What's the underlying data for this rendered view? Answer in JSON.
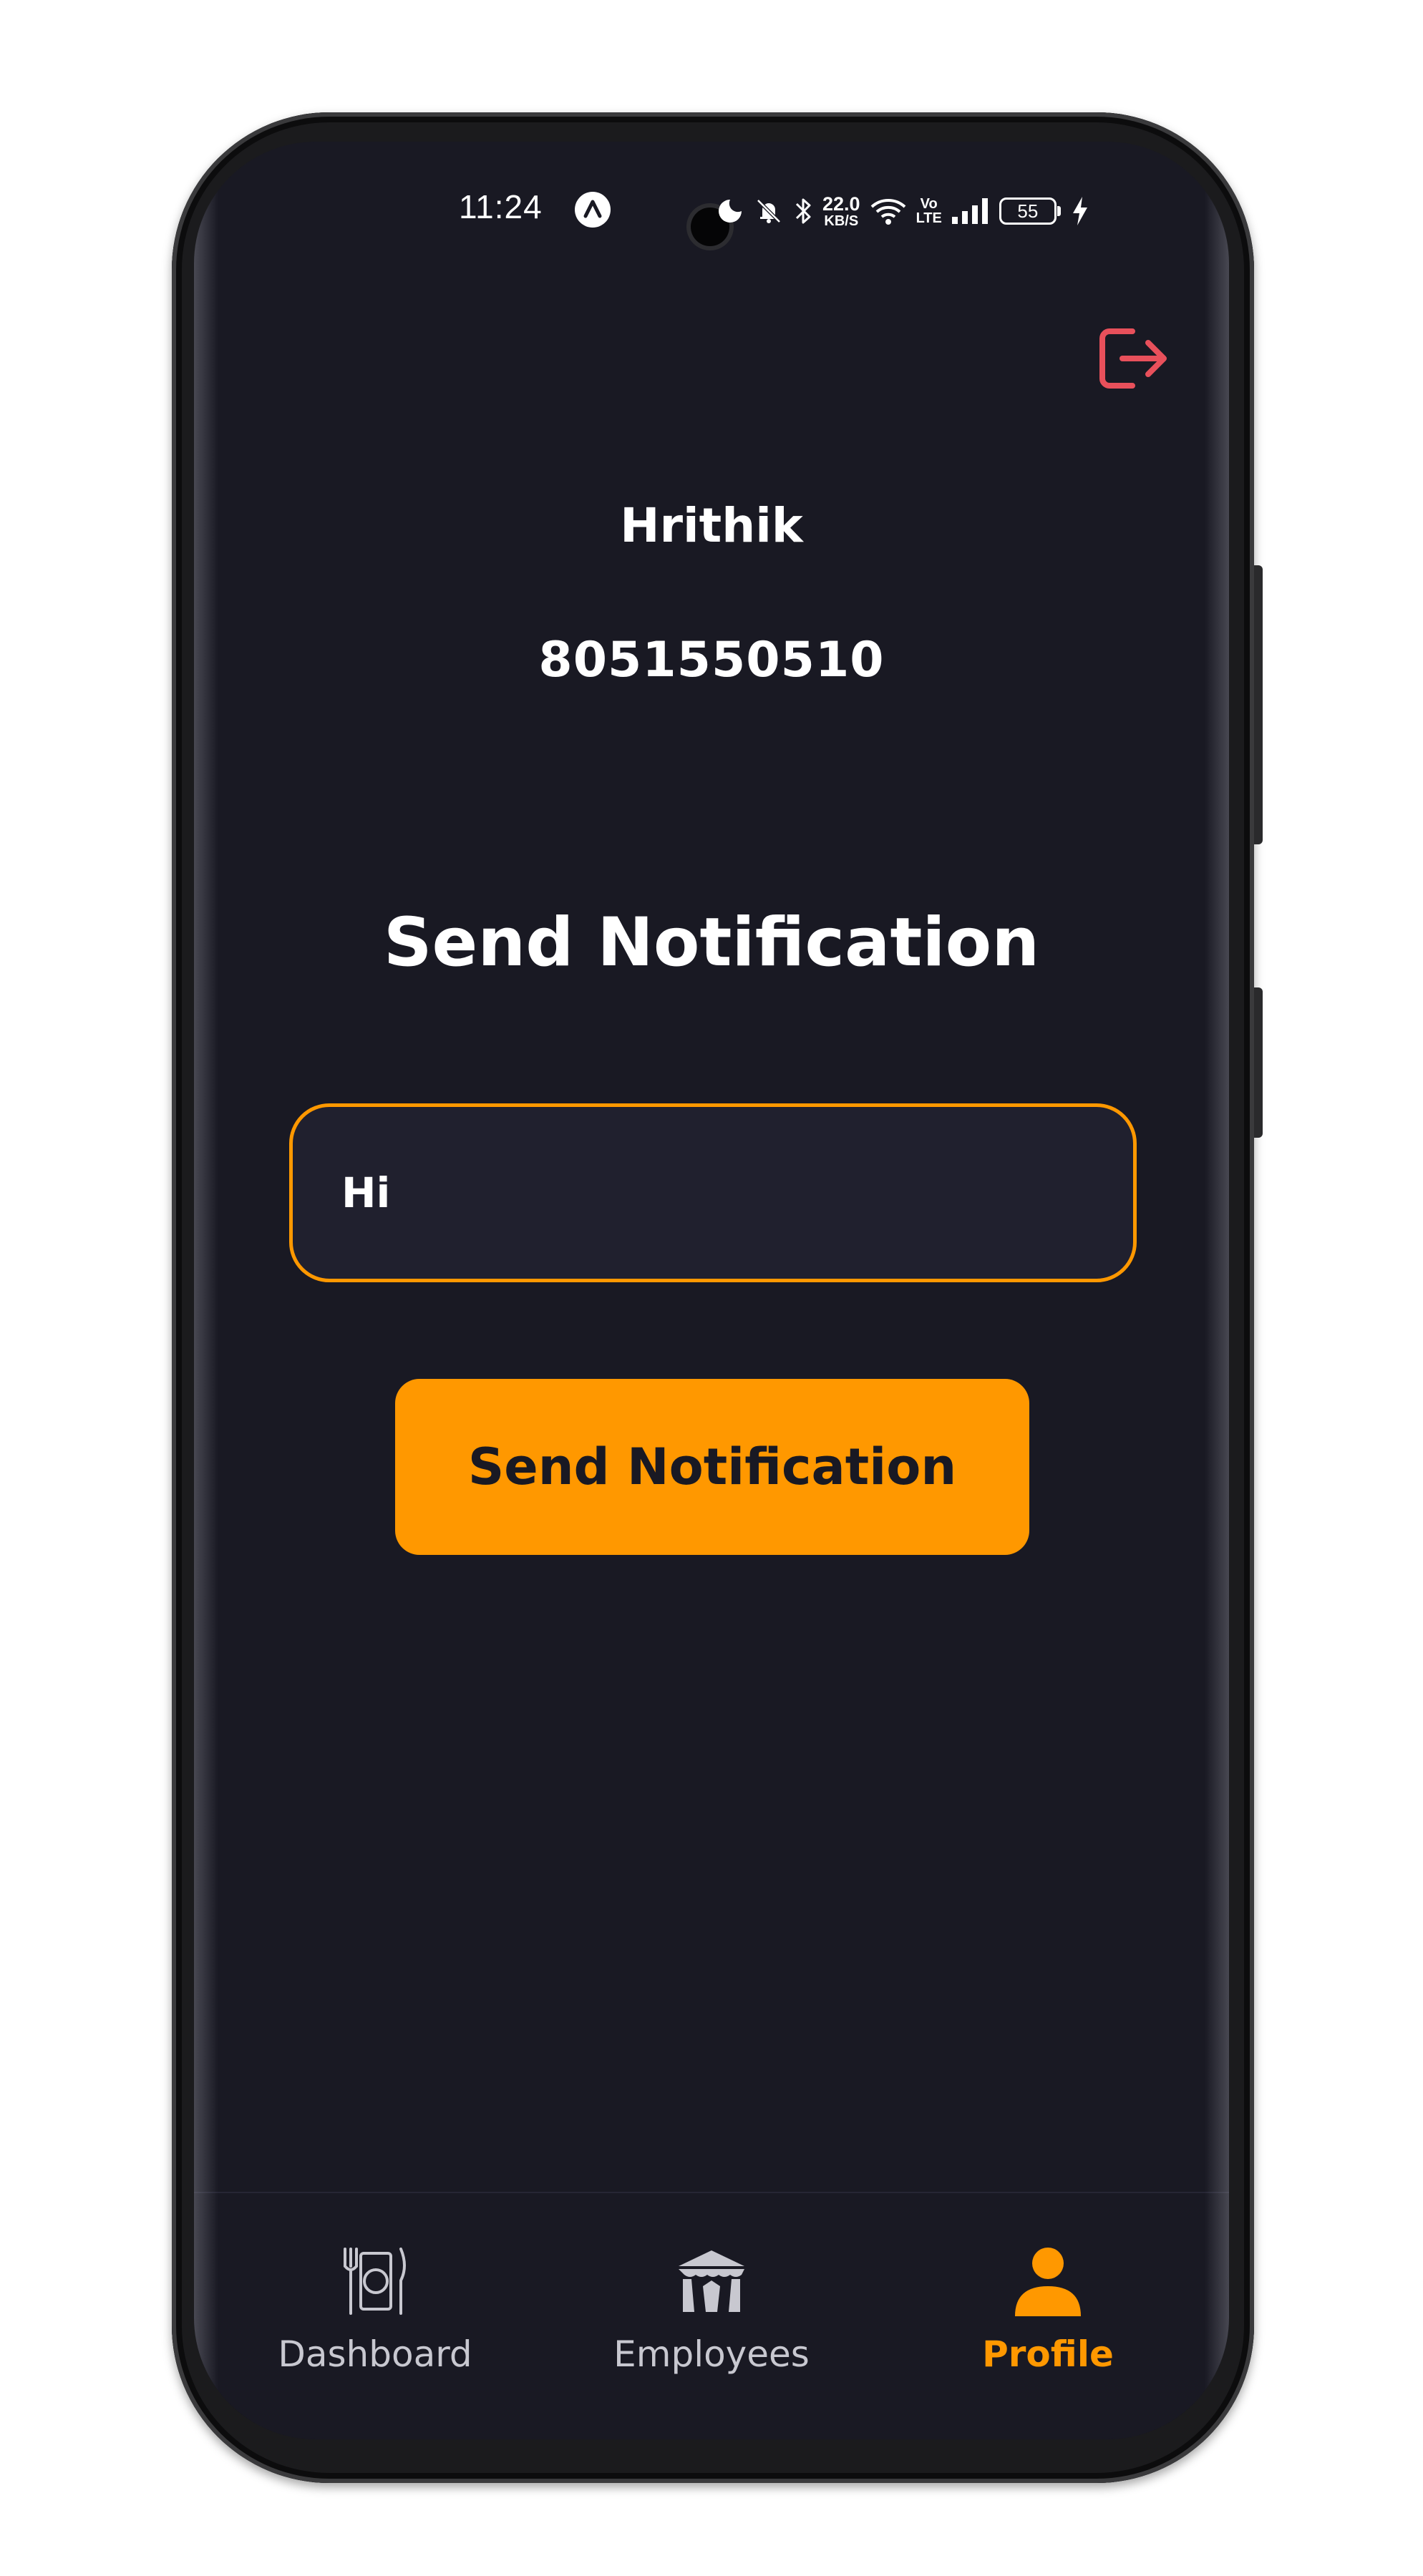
{
  "status_bar": {
    "time": "11:24",
    "net_speed_value": "22.0",
    "net_speed_unit": "KB/S",
    "volte_top": "Vo",
    "volte_bottom": "LTE",
    "battery_level": "55",
    "icons": [
      "app-a-icon",
      "dnd-icon",
      "mute-bell-icon",
      "bluetooth-icon",
      "wifi-icon",
      "signal-icon",
      "charging-icon"
    ]
  },
  "header": {
    "logout_icon": "logout-icon",
    "logout_color": "#e8505b"
  },
  "profile": {
    "name": "Hrithik",
    "phone": "8051550510"
  },
  "notification": {
    "title": "Send Notification",
    "input_value": "Hi",
    "button_label": "Send Notification"
  },
  "bottom_nav": {
    "items": [
      {
        "label": "Dashboard",
        "icon": "plate-cutlery-icon",
        "active": false
      },
      {
        "label": "Employees",
        "icon": "tent-icon",
        "active": false
      },
      {
        "label": "Profile",
        "icon": "person-icon",
        "active": true
      }
    ]
  },
  "colors": {
    "background": "#191923",
    "accent": "#ff9800",
    "input_background": "#20202e",
    "text": "#ffffff",
    "nav_inactive": "#c8c8d0"
  }
}
